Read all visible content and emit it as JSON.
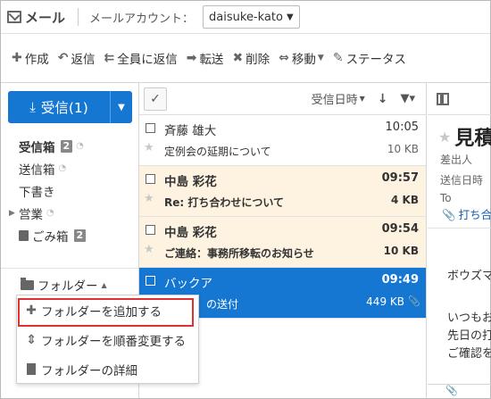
{
  "header": {
    "app_title": "メール",
    "account_label": "メールアカウント：",
    "account_value": "daisuke-kato"
  },
  "toolbar": {
    "compose": "作成",
    "reply": "返信",
    "reply_all": "全員に返信",
    "forward": "転送",
    "delete": "削除",
    "move": "移動",
    "status": "ステータス"
  },
  "left": {
    "receive_label": "受信(1)",
    "folders": [
      {
        "label": "受信箱",
        "badge": "2"
      },
      {
        "label": "送信箱"
      },
      {
        "label": "下書き"
      },
      {
        "label": "営業"
      },
      {
        "label": "ごみ箱",
        "badge": "2"
      }
    ],
    "folder_menu_label": "フォルダー"
  },
  "folder_dropdown": {
    "items": [
      {
        "label": "フォルダーを追加する",
        "icon": "plus-icon"
      },
      {
        "label": "フォルダーを順番変更する",
        "icon": "updown-arrow-icon"
      },
      {
        "label": "フォルダーの詳細",
        "icon": "document-icon"
      }
    ]
  },
  "list": {
    "sort_label": "受信日時",
    "messages": [
      {
        "from": "斉藤 雄大",
        "subject": "定例会の延期について",
        "time": "10:05",
        "size": "10 KB",
        "state": "read"
      },
      {
        "from": "中島 彩花",
        "subject": "Re: 打ち合わせについて",
        "time": "09:57",
        "size": "4 KB",
        "state": "unread"
      },
      {
        "from": "中島 彩花",
        "subject": "ご連絡：事務所移転のお知らせ",
        "time": "09:54",
        "size": "10 KB",
        "state": "unread"
      },
      {
        "from": "バックア",
        "subject": "の送付",
        "time": "09:49",
        "size": "449 KB",
        "state": "selected"
      }
    ]
  },
  "preview": {
    "title": "見積",
    "from_label": "差出人",
    "date_label": "送信日時",
    "to_label": "To",
    "attachment": "打ち合",
    "body": [
      "ボウズマ",
      "いつもお",
      "先日の打",
      "ご確認を"
    ]
  },
  "colors": {
    "accent": "#1677d2",
    "unread_bg": "#fdf3e0",
    "highlight_box": "#e03030"
  }
}
